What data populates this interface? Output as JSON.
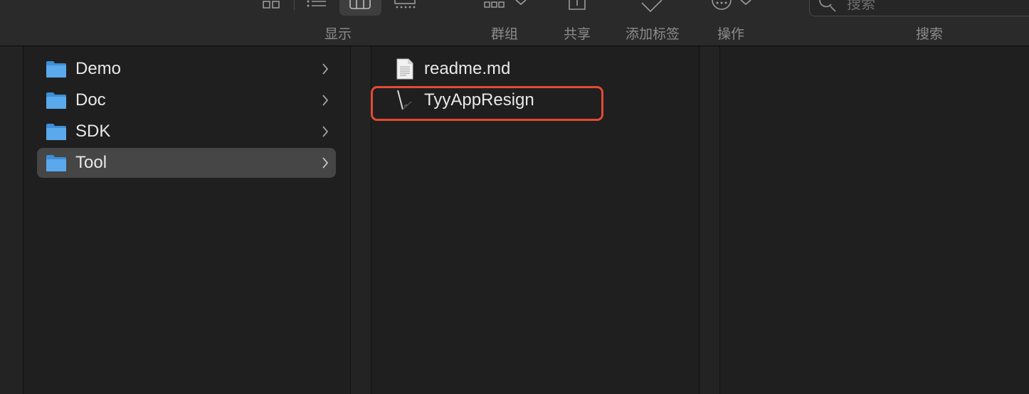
{
  "toolbar": {
    "groups": [
      {
        "id": "display",
        "label": "显示"
      },
      {
        "id": "group",
        "label": "群组"
      },
      {
        "id": "share",
        "label": "共享"
      },
      {
        "id": "tags",
        "label": "添加标签"
      },
      {
        "id": "action",
        "label": "操作"
      },
      {
        "id": "search",
        "label": "搜索"
      }
    ],
    "search_placeholder": "搜索",
    "view_modes": [
      "icon-view-icon",
      "list-view-icon",
      "column-view-icon",
      "gallery-view-icon"
    ],
    "active_view": "column-view-icon"
  },
  "column1": {
    "items": [
      {
        "label": "Demo",
        "type": "folder",
        "selected": false
      },
      {
        "label": "Doc",
        "type": "folder",
        "selected": false
      },
      {
        "label": "SDK",
        "type": "folder",
        "selected": false
      },
      {
        "label": "Tool",
        "type": "folder",
        "selected": true
      }
    ]
  },
  "column2": {
    "items": [
      {
        "label": "readme.md",
        "type": "text-file"
      },
      {
        "label": "TyyAppResign",
        "type": "application",
        "highlighted": true
      }
    ]
  },
  "colors": {
    "background": "#1f1f1f",
    "toolbar": "#2a2a2a",
    "selection": "#464646",
    "highlight_border": "#e34a33",
    "folder_blue": "#5aa9ec"
  }
}
